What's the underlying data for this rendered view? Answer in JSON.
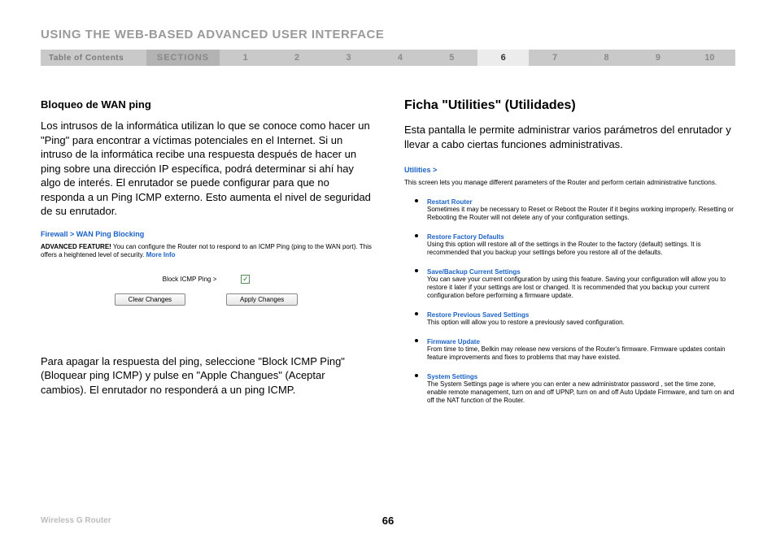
{
  "header": {
    "title": "USING THE WEB-BASED ADVANCED USER INTERFACE",
    "toc": "Table of Contents",
    "sections_label": "SECTIONS",
    "sections": [
      "1",
      "2",
      "3",
      "4",
      "5",
      "6",
      "7",
      "8",
      "9",
      "10"
    ],
    "active_index": 5
  },
  "left": {
    "heading": "Bloqueo de WAN ping",
    "para1": "Los intrusos de la informática utilizan lo que se conoce como hacer un \"Ping\" para encontrar a víctimas potenciales en el Internet. Si un intruso de la informática recibe una respuesta después de hacer un ping sobre una dirección IP específica, podrá determinar si ahí hay algo de interés. El enrutador se puede configurar para que no responda a un Ping ICMP externo. Esto aumenta el nivel de seguridad de su enrutador.",
    "breadcrumb": "Firewall > WAN Ping Blocking",
    "adv_bold": "ADVANCED FEATURE!",
    "adv_text": " You can configure the Router not to respond to an ICMP Ping (ping to the WAN port). This offers a heightened level of security. ",
    "more_info": "More Info",
    "checkbox_label": "Block ICMP Ping >",
    "checkbox_checked": "✓",
    "btn_clear": "Clear Changes",
    "btn_apply": "Apply Changes",
    "para2": "Para apagar la respuesta del ping, seleccione \"Block ICMP Ping\" (Bloquear ping ICMP) y pulse en \"Apple Changues\" (Aceptar cambios). El enrutador no responderá a un ping ICMP."
  },
  "right": {
    "heading": "Ficha \"Utilities\" (Utilidades)",
    "para1": "Esta pantalla le permite administrar varios parámetros del enrutador y llevar a cabo ciertas funciones administrativas.",
    "util_header": "Utilities >",
    "util_intro": "This screen lets you manage different parameters of the Router and perform certain administrative functions.",
    "items": [
      {
        "title": "Restart Router",
        "desc": "Sometimes it may be necessary to Reset or Reboot the Router if it begins working improperly. Resetting or Rebooting the Router will not delete any of your configuration settings."
      },
      {
        "title": "Restore Factory Defaults",
        "desc": "Using this option will restore all of the settings in the Router to the factory (default) settings. It is recommended that you backup your settings before you restore all of the defaults."
      },
      {
        "title": "Save/Backup Current Settings",
        "desc": "You can save your current configuration by using this feature. Saving your configuration will allow you to restore it later if your settings are lost or changed. It is recommended that you backup your current configuration before performing a firmware update."
      },
      {
        "title": "Restore Previous Saved Settings",
        "desc": "This option will allow you to restore a previously saved configuration."
      },
      {
        "title": "Firmware Update",
        "desc": "From time to time, Belkin may release new versions of the Router's firmware. Firmware updates contain feature improvements and fixes to problems that may have existed."
      },
      {
        "title": "System Settings",
        "desc": "The System Settings page is where you can enter a new administrator password , set the time zone, enable remote management, turn on and off UPNP, turn on and off Auto Update Firmware, and turn on and off the NAT function of the Router."
      }
    ]
  },
  "footer": {
    "product": "Wireless G Router",
    "page": "66"
  }
}
